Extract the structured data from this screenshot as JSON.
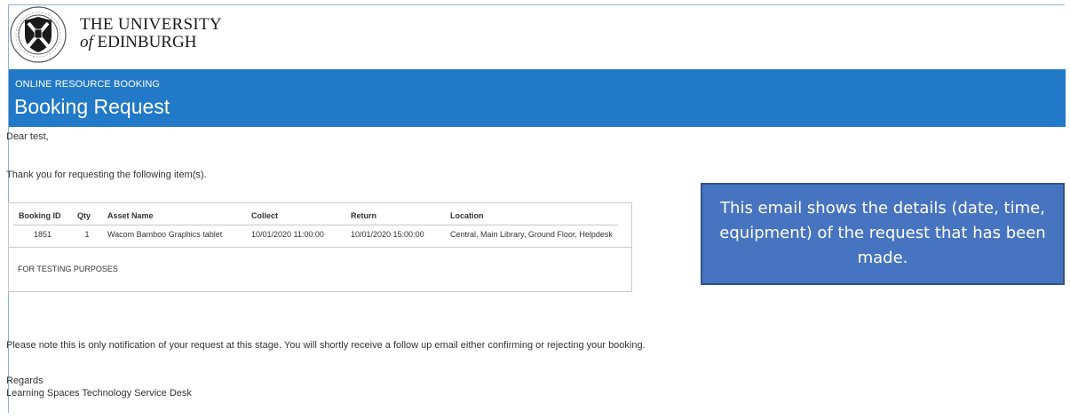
{
  "header": {
    "university_line1": "THE UNIVERSITY",
    "university_of": "of",
    "university_line2": "EDINBURGH",
    "banner_subtitle": "ONLINE RESOURCE BOOKING",
    "banner_title": "Booking Request"
  },
  "email": {
    "greeting": "Dear test,",
    "intro": "Thank you for requesting the following item(s).",
    "notice": "Please note this is only notification of your request at this stage. You will shortly receive a follow up email either confirming or rejecting your booking.",
    "regards": "Regards",
    "signature": "Learning Spaces Technology Service Desk"
  },
  "bookings": {
    "columns": [
      "Booking ID",
      "Qty",
      "Asset Name",
      "Collect",
      "Return",
      "Location"
    ],
    "rows": [
      {
        "booking_id": "1851",
        "qty": "1",
        "asset_name": "Wacom Bamboo Graphics tablet",
        "collect": "10/01/2020 11:00:00",
        "return": "10/01/2020 15:00:00",
        "location": "Central, Main Library, Ground Floor, Helpdesk"
      }
    ],
    "note": "FOR TESTING PURPOSES"
  },
  "callout": {
    "text": "This email shows the details (date, time, equipment) of the request that has been made."
  },
  "colors": {
    "banner": "#2179c8",
    "callout_fill": "#4674c1",
    "callout_border": "#2f528f"
  }
}
